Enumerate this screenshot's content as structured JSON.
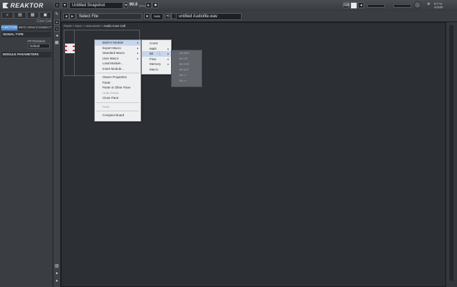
{
  "app": {
    "logo_text": "REAKTOR"
  },
  "topbar": {
    "snapshot": "Untitled Snapshot",
    "tempo": "90.0",
    "tempo_unit": "BPM",
    "cpu": "0.7 %",
    "rate": "44100"
  },
  "side": {
    "tabs": [
      "⌕",
      "▤",
      "▦",
      "▣"
    ],
    "path": "Core Cell",
    "subtabs": [
      "FUNCTION",
      "INFO",
      "VIEW",
      "CONNECT"
    ],
    "signal_type": "SIGNAL TYPE",
    "fp_precision_label": "FP Precision",
    "fp_precision_value": "Default",
    "module_parameters": "MODULE PARAMETERS"
  },
  "header2": {
    "select_file": "Select File",
    "auto": "Auto",
    "audio_file": "untitled Audiofile.wav"
  },
  "breadcrumb": [
    "Panel",
    "Num",
    "Instrument",
    "Audio Core Cell"
  ],
  "context_menu": {
    "items": [
      {
        "label": "Built-In Module",
        "arrow": "▸",
        "hl": true
      },
      {
        "label": "Expert Macro",
        "arrow": "▸"
      },
      {
        "label": "Standard Macro",
        "arrow": "▸"
      },
      {
        "label": "User Macro",
        "arrow": "▸"
      },
      {
        "label": "Load Module..."
      },
      {
        "label": "Insert Module..."
      }
    ],
    "items2": [
      {
        "label": "Owner Properties"
      },
      {
        "label": "Paste"
      },
      {
        "label": "Paste in Other Pane"
      },
      {
        "label": "Undo Paste",
        "dis": true
      },
      {
        "label": "Close Pane"
      }
    ],
    "items3": [
      {
        "label": "Redo",
        "dis": true
      }
    ],
    "items4": [
      {
        "label": "Compact Board"
      }
    ]
  },
  "submenu": {
    "items": [
      {
        "label": "Const"
      },
      {
        "label": "Math",
        "arrow": "▸"
      },
      {
        "label": "Bit",
        "arrow": "▸",
        "hl": true
      },
      {
        "label": "Flow",
        "arrow": "▸"
      },
      {
        "label": "Memory",
        "arrow": "▸"
      },
      {
        "label": "Macro"
      }
    ]
  },
  "bits_menu": {
    "items": [
      "Bit AND",
      "Bit OR",
      "Bit XOR",
      "Bit NOT",
      "Bit <<",
      "Bit >>"
    ]
  }
}
